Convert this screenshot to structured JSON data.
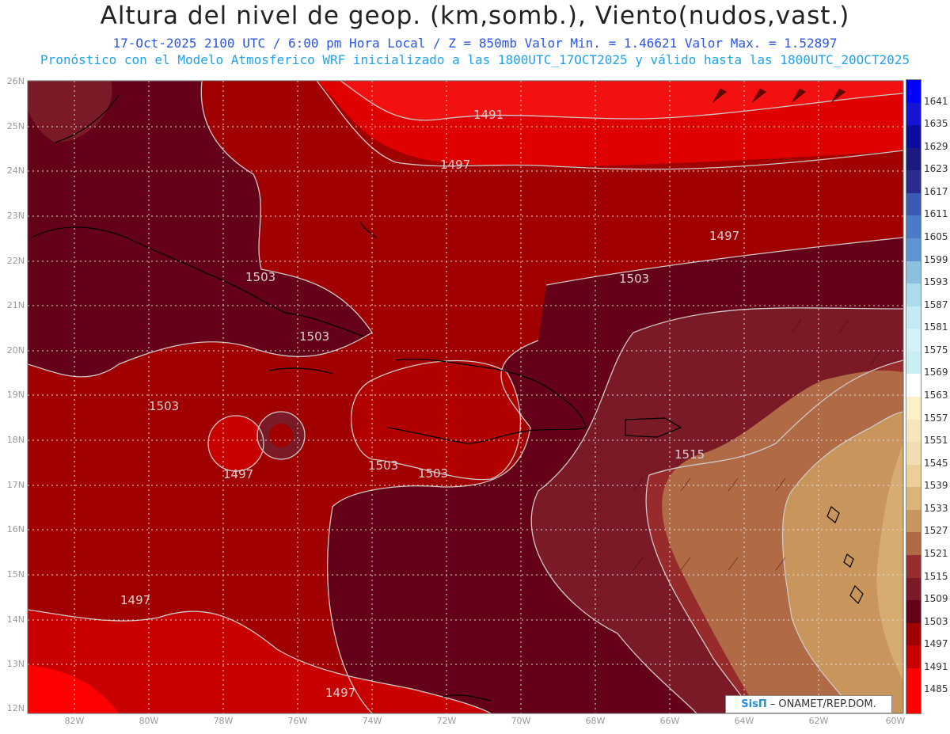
{
  "title": "Altura del nivel de geop. (km,somb.), Viento(nudos,vast.)",
  "subtitle1": "17-Oct-2025  2100 UTC / 6:00 pm Hora Local / Z = 850mb    Valor Min. = 1.46621  Valor Max. = 1.52897",
  "subtitle2": "Pronóstico con el Modelo Atmosferico WRF inicializado a las 1800UTC_17OCT2025 y válido hasta las  1800UTC_20OCT2025",
  "lat_labels": [
    "26N",
    "25N",
    "24N",
    "23N",
    "22N",
    "21N",
    "20N",
    "19N",
    "18N",
    "17N",
    "16N",
    "15N",
    "14N",
    "13N",
    "12N"
  ],
  "lon_labels": [
    "82W",
    "80W",
    "78W",
    "76W",
    "74W",
    "72W",
    "70W",
    "68W",
    "66W",
    "64W",
    "62W",
    "60W"
  ],
  "colorbar": {
    "levels": [
      "1641",
      "1635",
      "1629",
      "1623",
      "1617",
      "1611",
      "1605",
      "1599",
      "1593",
      "1587",
      "1581",
      "1575",
      "1569",
      "1563",
      "1557",
      "1551",
      "1545",
      "1539",
      "1533",
      "1527",
      "1521",
      "1515",
      "1509",
      "1503",
      "1497",
      "1491",
      "1485"
    ],
    "colors": [
      "#0000ff",
      "#1414d2",
      "#0c0c9e",
      "#1a1a80",
      "#2a2a90",
      "#3a5ab4",
      "#4a7ac8",
      "#5e94d0",
      "#8cc0e0",
      "#aadcee",
      "#c4ebf4",
      "#d4f0f8",
      "#c8f0f4",
      "#ffffff",
      "#fbf0c8",
      "#f6e6be",
      "#f0deb0",
      "#ead096",
      "#ddb478",
      "#c8955c",
      "#b06a46",
      "#972c2c",
      "#7a1a26",
      "#640018",
      "#a00000",
      "#c80000",
      "#ff0000"
    ]
  },
  "contour_labels": [
    "1491",
    "1497",
    "1497",
    "1503",
    "1503",
    "1503",
    "1503",
    "1497",
    "1503",
    "1503",
    "1515",
    "1497",
    "1497"
  ],
  "credit": {
    "brand": "SisΠ",
    "text": "– ONAMET/REP.DOM."
  }
}
